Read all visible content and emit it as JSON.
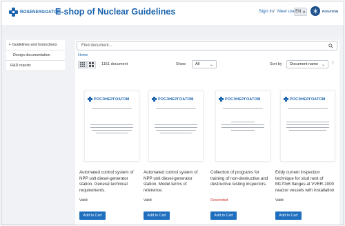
{
  "header": {
    "logo_text": "ROSENERGOATOM",
    "title": "E-shop of Nuclear Guidelines",
    "sign_in": "Sign in",
    "separator": "/",
    "new_user": "New user",
    "language": "EN",
    "rosatom_text": "ROSATOM"
  },
  "sidebar": {
    "items": [
      {
        "label": "Guidelines and Instructions",
        "expanded": true
      },
      {
        "label": "Design documentation"
      },
      {
        "label": "R&D reports"
      }
    ]
  },
  "search": {
    "placeholder": "Find document..."
  },
  "breadcrumb": {
    "home": "Home"
  },
  "toolbar": {
    "count": "1151 document",
    "show_label": "Show",
    "show_value": "All",
    "sort_label": "Sort by",
    "sort_value": "Document name",
    "sort_direction": "ascending"
  },
  "documents": [
    {
      "title": "Automated control system of NPP unit diesel-generator station. General technical requirements.",
      "status": "Valid",
      "button": "Add to Cart",
      "thumb_logo": "РОСЭНЕРГОАТОМ"
    },
    {
      "title": "Automated control system of NPP unit diesel-generator station. Model terms of reference.",
      "status": "Valid",
      "button": "Add to Cart",
      "thumb_logo": "РОСЭНЕРГОАТОМ"
    },
    {
      "title": "Collection of programs for training of non-destructive and destructive testing inspectors.",
      "status": "Rescinded",
      "button": "Add to Cart",
      "thumb_logo": "РОСЭНЕРГОАТОМ"
    },
    {
      "title": "Eddy current inspection technique for stud nest of M170x6 flanges at VVER-1000 reactor vessels with installation",
      "status": "Valid",
      "button": "Add to Cart",
      "thumb_logo": "РОСЭНЕРГОАТОМ"
    }
  ],
  "colors": {
    "brand": "#1a63ad",
    "button": "#1f6fbf",
    "rescinded": "#d0342c",
    "background": "#f0f2f5"
  }
}
